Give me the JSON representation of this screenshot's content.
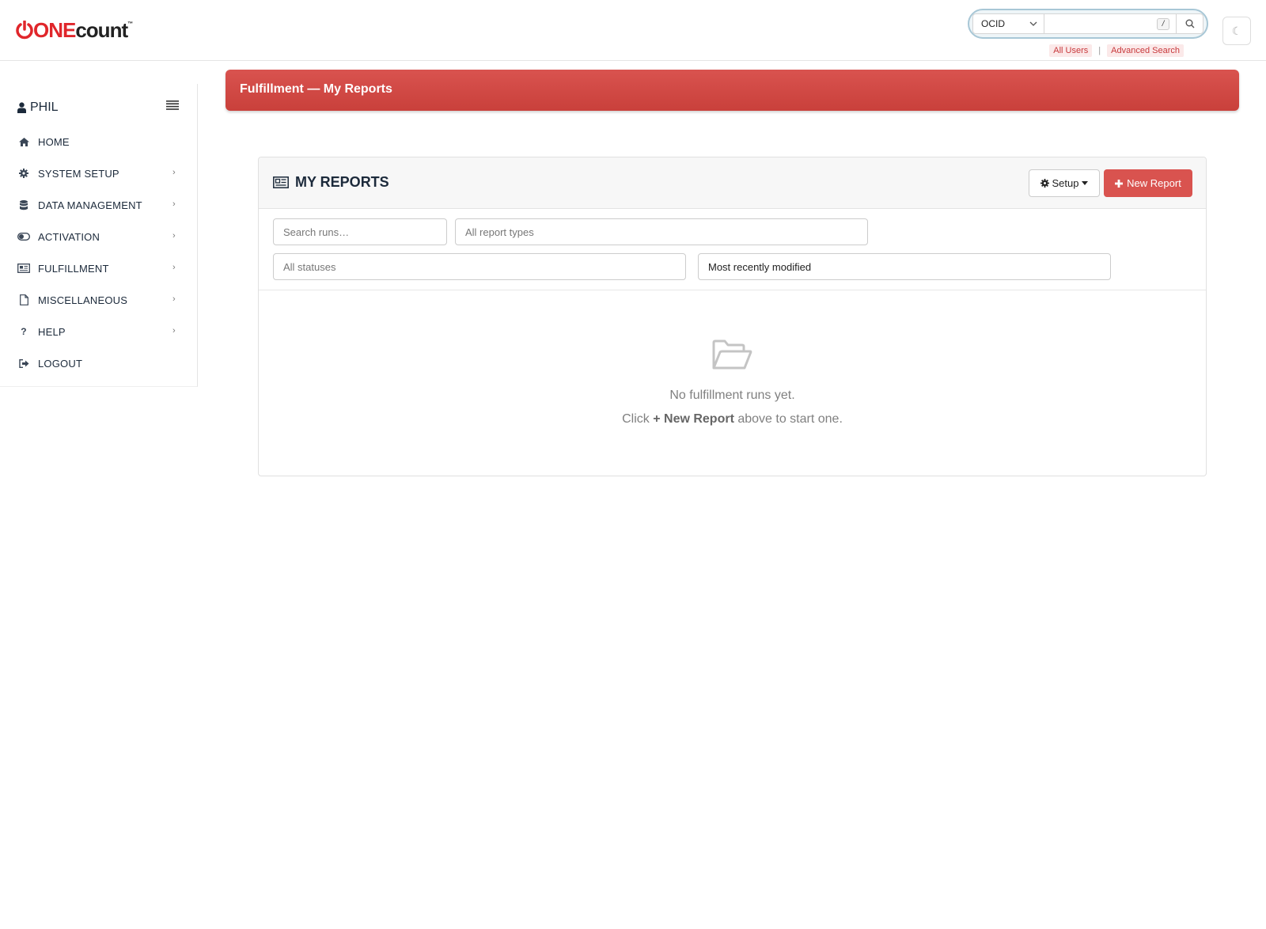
{
  "brand": {
    "one": "ONE",
    "count": "count",
    "tm": "™",
    "accent": "#e0262b"
  },
  "search": {
    "selected_type": "OCID",
    "input_value": "",
    "kbd_hint": "/",
    "links": [
      "All Users",
      "Advanced Search"
    ],
    "separator": "|"
  },
  "theme_toggle": {
    "glyph": "☾"
  },
  "sidebar": {
    "user_name": "PHIL",
    "items": [
      {
        "label": "HOME",
        "icon": "home-icon",
        "has_submenu": false
      },
      {
        "label": "SYSTEM SETUP",
        "icon": "gear-icon",
        "has_submenu": true
      },
      {
        "label": "DATA MANAGEMENT",
        "icon": "database-icon",
        "has_submenu": true
      },
      {
        "label": "ACTIVATION",
        "icon": "toggle-icon",
        "has_submenu": true
      },
      {
        "label": "FULFILLMENT",
        "icon": "newspaper-icon",
        "has_submenu": true
      },
      {
        "label": "MISCELLANEOUS",
        "icon": "file-icon",
        "has_submenu": true
      },
      {
        "label": "HELP",
        "icon": "question-icon",
        "has_submenu": true
      },
      {
        "label": "LOGOUT",
        "icon": "sign-out-icon",
        "has_submenu": false
      }
    ],
    "chevron": "›"
  },
  "banner": {
    "title": "Fulfillment — My Reports",
    "color": "#d9534f"
  },
  "panel": {
    "title": "MY REPORTS",
    "setup_label": "Setup",
    "new_report_label": "New Report",
    "filters": {
      "search_placeholder": "Search runs…",
      "report_type": "All report types",
      "status": "All statuses",
      "sort": "Most recently modified"
    },
    "empty": {
      "line1": "No fulfillment runs yet.",
      "line2_prefix": "Click ",
      "line2_bold": "+ New Report",
      "line2_suffix": " above to start one."
    }
  }
}
